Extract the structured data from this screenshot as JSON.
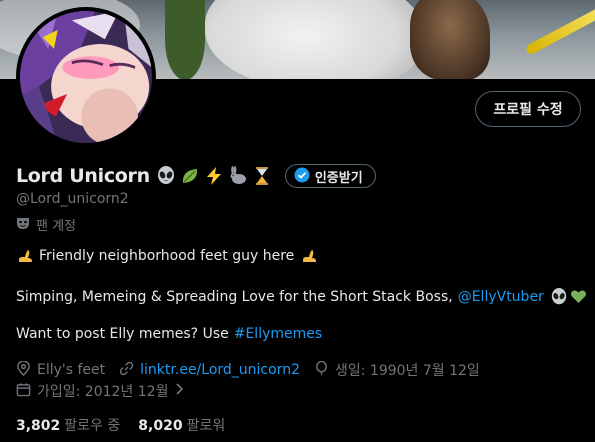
{
  "profile": {
    "display_name": "Lord Unicorn",
    "name_emoji_icons": [
      "alien-icon",
      "leaf-icon",
      "lightning-icon",
      "rabbit-icon",
      "hourglass-icon"
    ],
    "handle": "@Lord_unicorn2",
    "account_type": "팬 계정",
    "verify_label": "인증받기",
    "edit_label": "프로필 수정"
  },
  "bio": {
    "line1": {
      "text": "Friendly neighborhood feet guy here"
    },
    "line2": {
      "text": "Simping, Memeing & Spreading Love for the Short Stack Boss,",
      "mention": "@EllyVtuber"
    },
    "line3": {
      "text": "Want to post Elly memes? Use",
      "hashtag": "#Ellymemes"
    }
  },
  "meta": {
    "location": "Elly's feet",
    "website": "linktr.ee/Lord_unicorn2",
    "birthday": "생일: 1990년 7월 12일",
    "joined": "가입일: 2012년 12월"
  },
  "stats": {
    "following_count": "3,802",
    "following_label": "팔로우 중",
    "followers_count": "8,020",
    "followers_label": "팔로워"
  },
  "colors": {
    "accent": "#1d9bf0",
    "muted": "#71767b",
    "text": "#e7e9ea",
    "background": "#000000"
  }
}
